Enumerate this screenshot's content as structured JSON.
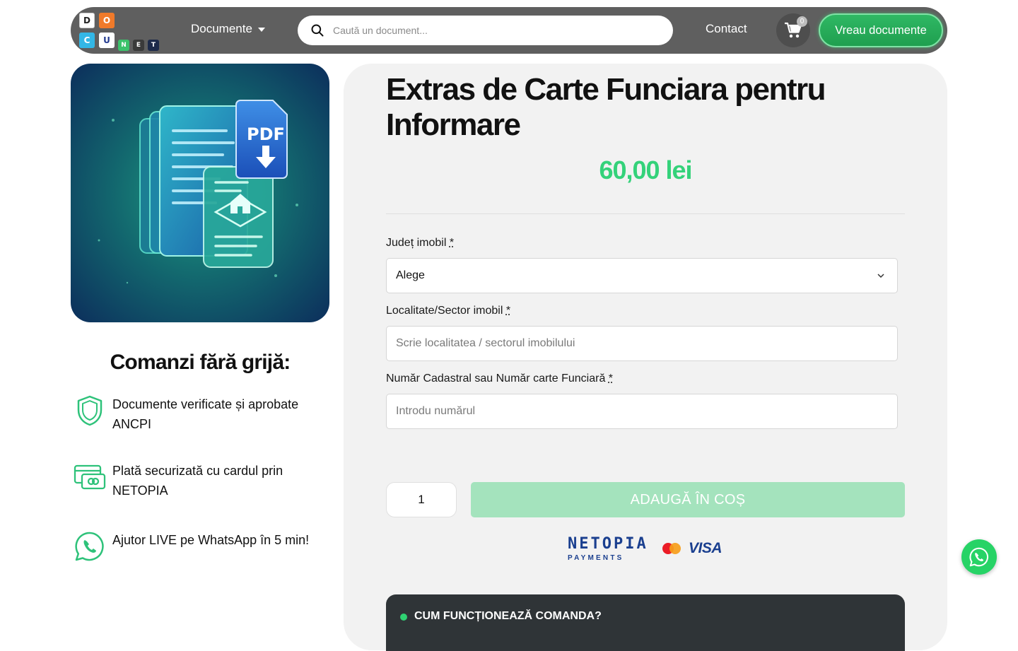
{
  "header": {
    "logo_letters": [
      "D",
      "O",
      "C",
      "U",
      "N",
      "E",
      "T"
    ],
    "nav_documents": "Documente",
    "search_placeholder": "Caută un document...",
    "nav_contact": "Contact",
    "cart_count": "0",
    "cta_label": "Vreau documente"
  },
  "product_image": {
    "pdf_label": "PDF"
  },
  "left": {
    "title": "Comanzi fără grijă:",
    "features": [
      {
        "icon": "shield-icon",
        "text": "Documente verificate și aprobate ANCPI"
      },
      {
        "icon": "credit-card-icon",
        "text": "Plată securizată cu cardul prin NETOPIA"
      },
      {
        "icon": "whatsapp-icon",
        "text": "Ajutor LIVE pe WhatsApp în 5 min!"
      }
    ]
  },
  "product": {
    "title": "Extras de Carte Funciara pentru Informare",
    "price": "60,00 lei"
  },
  "form": {
    "county_label": "Județ imobil",
    "county_value": "Alege",
    "locality_label": "Localitate/Sector imobil",
    "locality_placeholder": "Scrie localitatea / sectorul imobilului",
    "cadastral_label": "Număr Cadastral sau Număr carte Funciară",
    "cadastral_placeholder": "Introdu numărul",
    "required_mark": "*",
    "quantity": "1",
    "add_to_cart": "ADAUGĂ ÎN COȘ"
  },
  "payments": {
    "netopia_top": "NETOPIA",
    "netopia_bottom": "PAYMENTS",
    "visa": "VISA"
  },
  "how_it_works": {
    "title": "CUM FUNCȚIONEAZĂ COMANDA?"
  },
  "colors": {
    "brand_green": "#34d27a",
    "header_bg": "#5f5f5f",
    "panel_bg": "#f2f2f2",
    "netopia_blue": "#1a3f8f"
  }
}
